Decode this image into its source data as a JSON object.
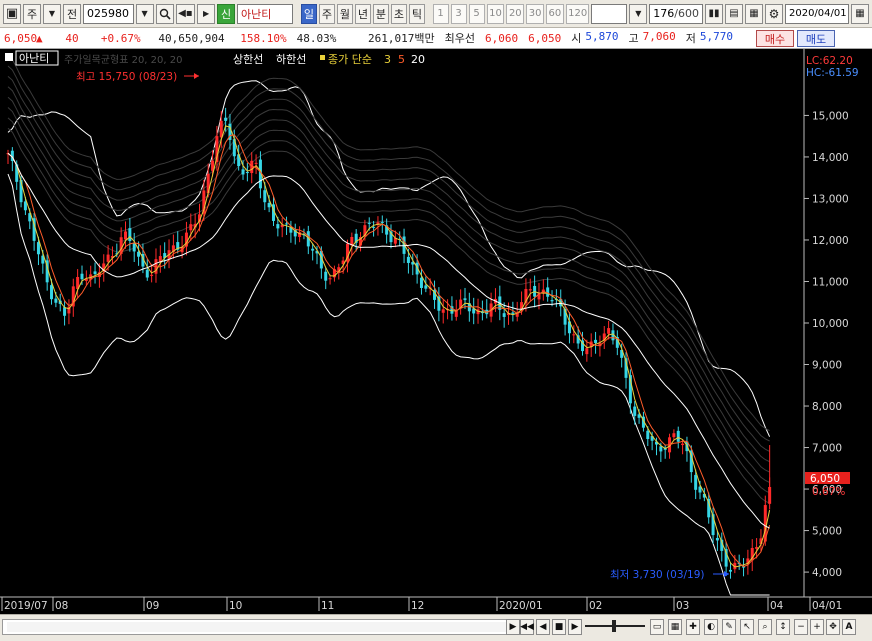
{
  "toolbar": {
    "menu_icon": "menu-icon",
    "mode_label": "주",
    "jeon_label": "전",
    "code_value": "025980",
    "name_badge": "신",
    "name_value": "아난티",
    "periods": [
      "일",
      "주",
      "월",
      "년",
      "분",
      "초",
      "틱"
    ],
    "active_period": "일",
    "nums": [
      "1",
      "3",
      "5",
      "10",
      "20",
      "30",
      "60",
      "120"
    ],
    "count_value": "176",
    "count_total": "/600",
    "date_value": "2020/04/01"
  },
  "quote": {
    "price": "6,050",
    "change": "40",
    "change_pct": "+0.67%",
    "volume": "40,650,904",
    "vol_ratio": "158.10%",
    "turnover": "48.03%",
    "amount": "261,017백만",
    "best_label": "최우선",
    "best_ask": "6,060",
    "best_bid": "6,050",
    "open_label": "시",
    "open": "5,870",
    "high_label": "고",
    "high": "7,060",
    "low_label": "저",
    "low": "5,770",
    "buy_label": "매수",
    "sell_label": "매도"
  },
  "chart": {
    "stock_tag": "아난티",
    "legend_dim": "주가일목균형표 20, 20, 20",
    "legend_upper": "상한선",
    "legend_lower": "하한선",
    "legend_ma": "종가 단순",
    "ma_periods": [
      "3",
      "5",
      "20"
    ],
    "lc": "LC:62.20",
    "hc": "HC:-61.59",
    "current_price": "6,050",
    "current_pct": "0.67%",
    "high_annot": "최고 15,750 (08/23)",
    "low_annot": "최저 3,730 (03/19)"
  },
  "chart_data": {
    "type": "candlestick",
    "y_ticks": [
      "15,000",
      "14,000",
      "13,000",
      "12,000",
      "11,000",
      "10,000",
      "9,000",
      "8,000",
      "7,000",
      "6,000",
      "5,000",
      "4,000"
    ],
    "ylim": [
      3400,
      16600
    ],
    "x_ticks": [
      "2019/07",
      "08",
      "09",
      "10",
      "11",
      "12",
      "2020/01",
      "02",
      "03",
      "04",
      "04/01"
    ],
    "close_path": [
      14000,
      13400,
      12600,
      11800,
      11000,
      10600,
      10100,
      10900,
      11300,
      11000,
      11400,
      11700,
      12100,
      11900,
      11400,
      11200,
      11500,
      11800,
      11900,
      12100,
      12600,
      13600,
      14500,
      14900,
      13800,
      13600,
      13800,
      13000,
      12400,
      12200,
      12300,
      12100,
      11700,
      11300,
      11100,
      11400,
      12000,
      12200,
      12300,
      12400,
      12200,
      11900,
      11500,
      11200,
      10800,
      10400,
      10300,
      10400,
      10400,
      10300,
      10300,
      10400,
      10300,
      10200,
      10500,
      10800,
      10800,
      10600,
      10300,
      9900,
      9400,
      9300,
      9700,
      9800,
      9400,
      8600,
      7700,
      7300,
      7000,
      7100,
      7200,
      7100,
      6300,
      5700,
      5000,
      4500,
      4000,
      4100,
      4500,
      4800,
      6050
    ]
  }
}
